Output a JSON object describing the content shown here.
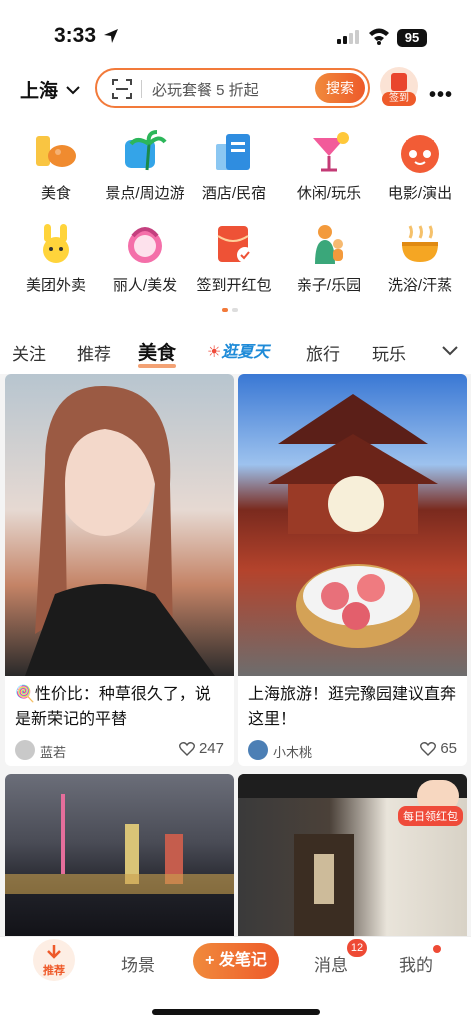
{
  "status_bar": {
    "time": "3:33",
    "battery": "95"
  },
  "header": {
    "city": "上海",
    "search_placeholder": "必玩套餐 5 折起",
    "search_button": "搜索",
    "checkin_label": "签到"
  },
  "categories": [
    {
      "label": "美食",
      "icon": "food-icon"
    },
    {
      "label": "景点/周边游",
      "icon": "palm-tree-icon"
    },
    {
      "label": "酒店/民宿",
      "icon": "hotel-icon"
    },
    {
      "label": "休闲/玩乐",
      "icon": "cocktail-icon"
    },
    {
      "label": "电影/演出",
      "icon": "cat-movie-icon"
    },
    {
      "label": "美团外卖",
      "icon": "kangaroo-icon"
    },
    {
      "label": "丽人/美发",
      "icon": "beauty-icon"
    },
    {
      "label": "签到开红包",
      "icon": "red-packet-icon"
    },
    {
      "label": "亲子/乐园",
      "icon": "parent-child-icon"
    },
    {
      "label": "洗浴/汗蒸",
      "icon": "bath-icon"
    }
  ],
  "tabs": [
    "关注",
    "推荐",
    "美食",
    "逛夏天",
    "旅行",
    "玩乐"
  ],
  "active_tab": "美食",
  "feed": [
    {
      "title": "🍭性价比：种草很久了，说是新荣记的平替",
      "author": "蓝若",
      "likes": "247"
    },
    {
      "title": "上海旅游！逛完豫园建议直奔这里！",
      "author": "小木桃",
      "likes": "65"
    },
    {
      "title": "",
      "author": "",
      "likes": ""
    },
    {
      "title": "",
      "author": "",
      "likes": "",
      "badge": "每日领红包"
    }
  ],
  "bottom_nav": {
    "home": "推荐",
    "scene": "场景",
    "post": "+ 发笔记",
    "messages": "消息",
    "messages_badge": "12",
    "me": "我的"
  },
  "colors": {
    "accent": "#ee5a2a",
    "accent_light": "#f27a3a"
  }
}
